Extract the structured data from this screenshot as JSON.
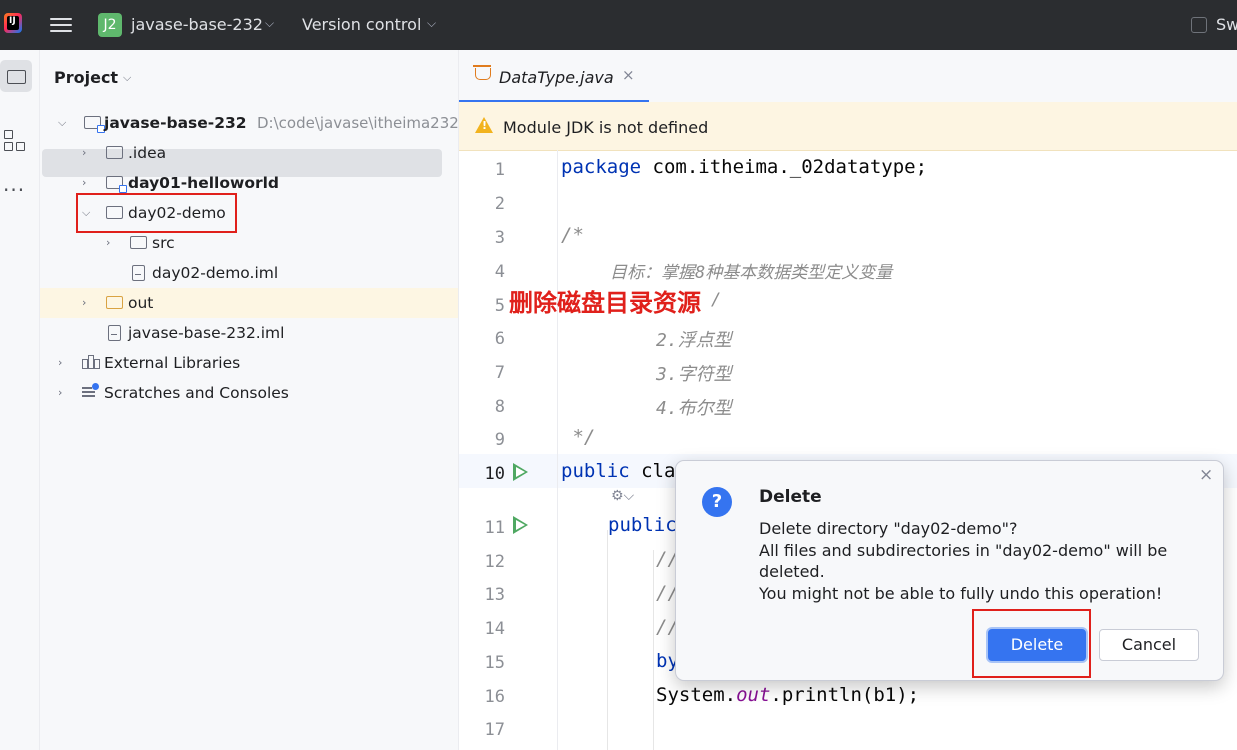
{
  "titlebar": {
    "project_badge": "J2",
    "project_name": "javase-base-232",
    "version_control": "Version control",
    "right_label": "Sw"
  },
  "project_panel": {
    "header": "Project",
    "tree": [
      {
        "label": "javase-base-232",
        "path": "D:\\code\\javase\\itheima232"
      },
      {
        "label": ".idea"
      },
      {
        "label": "day01-helloworld"
      },
      {
        "label": "day02-demo"
      },
      {
        "label": "src"
      },
      {
        "label": "day02-demo.iml"
      },
      {
        "label": "out"
      },
      {
        "label": "javase-base-232.iml"
      },
      {
        "label": "External Libraries"
      },
      {
        "label": "Scratches and Consoles"
      }
    ]
  },
  "editor": {
    "tab_name": "DataType.java",
    "tab_close": "×",
    "warning": "Module JDK is not defined",
    "line_numbers": [
      "1",
      "2",
      "3",
      "4",
      "5",
      "6",
      "7",
      "8",
      "9",
      "10",
      "11",
      "12",
      "13",
      "14",
      "15",
      "16",
      "17"
    ],
    "code": {
      "l1_kw": "package",
      "l1_rest": " com.itheima._02datatype;",
      "l3": "/*",
      "l4": "目标：掌握8种基本数据类型定义变量",
      "l5_tail": "/",
      "l6": "2.浮点型",
      "l7": "3.字符型",
      "l8": "4.布尔型",
      "l9": " */",
      "l10_kw": "public",
      "l10_rest": " cla",
      "l11": "public",
      "l12": "//",
      "l13": "//",
      "l14": "//",
      "l15": "by",
      "l16_a": "System.",
      "l16_b": "out",
      "l16_c": ".println(b1);"
    }
  },
  "annotation": "删除磁盘目录资源",
  "dialog": {
    "title": "Delete",
    "line1": "Delete directory \"day02-demo\"?",
    "line2": "All files and subdirectories in \"day02-demo\" will be",
    "line3": "deleted.",
    "line4": "You might not be able to fully undo this operation!",
    "delete_label": "Delete",
    "cancel_label": "Cancel",
    "close": "×"
  },
  "colors": {
    "accent": "#3574f0",
    "highlight_red": "#e0201b",
    "run_green": "#4fa862",
    "warning_bg": "#fdf5e2"
  }
}
